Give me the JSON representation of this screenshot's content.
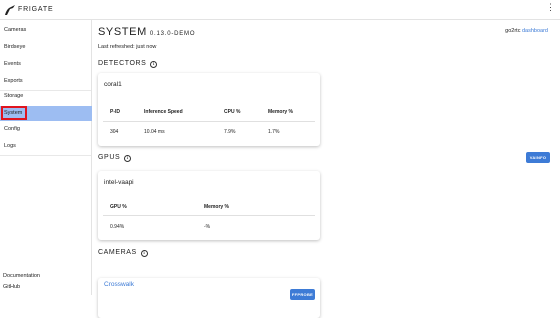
{
  "header": {
    "brand": "FRIGATE",
    "menu_icon": "more-vertical-icon",
    "logo_icon": "frigate-bird-icon"
  },
  "sidebar": {
    "items": [
      {
        "label": "Cameras"
      },
      {
        "label": "Birdseye"
      },
      {
        "label": "Events"
      },
      {
        "label": "Exports"
      },
      {
        "label": "Storage"
      },
      {
        "label": "System",
        "active": true
      },
      {
        "label": "Config"
      },
      {
        "label": "Logs"
      }
    ],
    "bottom": [
      {
        "label": "Documentation"
      },
      {
        "label": "GitHub"
      }
    ]
  },
  "page": {
    "title": "SYSTEM",
    "version": "0.13.0-DEMO",
    "refreshed": "Last refreshed: just now",
    "go2rtc_prefix": "go2rtc",
    "go2rtc_link": "dashboard"
  },
  "detectors": {
    "heading": "DETECTORS",
    "card": {
      "name": "coral1",
      "headers": [
        "P-ID",
        "Inference Speed",
        "CPU %",
        "Memory %"
      ],
      "row": [
        "304",
        "10.04 ms",
        "7.9%",
        "1.7%"
      ]
    }
  },
  "gpus": {
    "heading": "GPUS",
    "button": "VAINFO",
    "card": {
      "name": "intel-vaapi",
      "headers": [
        "GPU %",
        "Memory %"
      ],
      "row": [
        "0.94%",
        "-%"
      ]
    }
  },
  "cameras": {
    "heading": "CAMERAS",
    "card": {
      "name": "Crosswalk",
      "button": "FFPROBE"
    }
  },
  "colors": {
    "accent": "#3d7bd6",
    "active_nav": "#9dbdf2",
    "highlight_box": "#e0141e"
  }
}
